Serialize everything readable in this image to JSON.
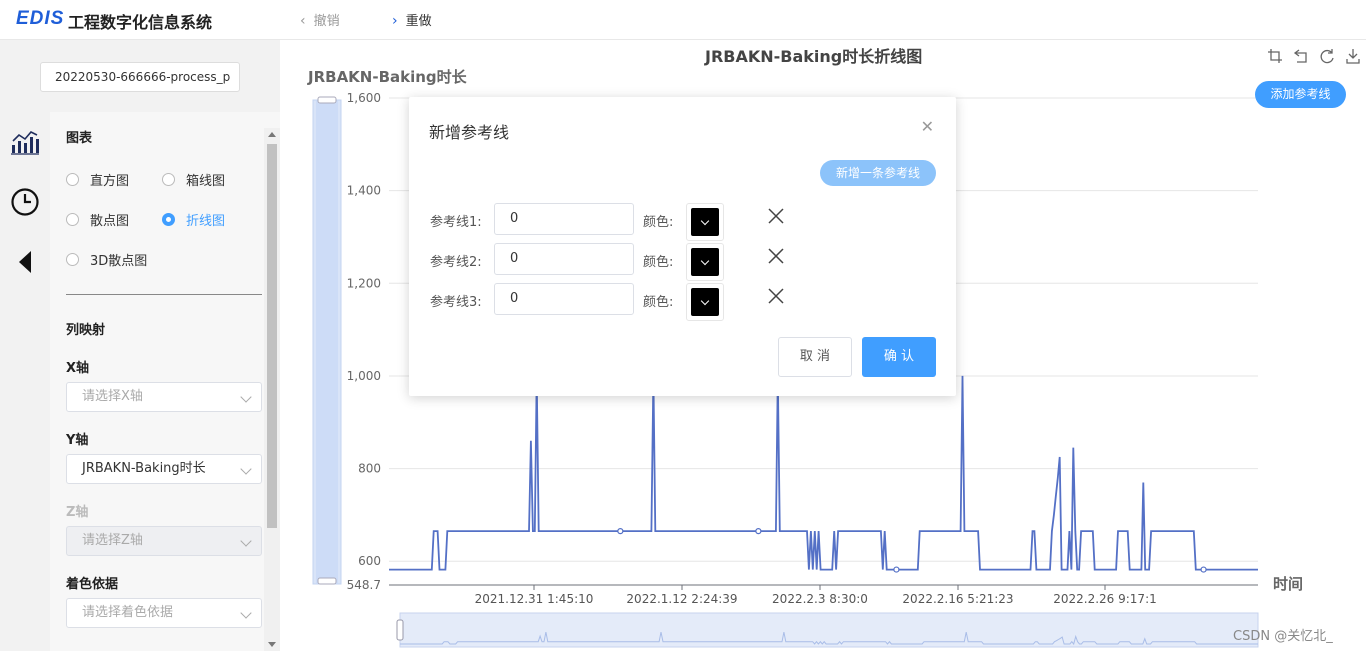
{
  "header": {
    "logo": "EDIS",
    "app_title": "工程数字化信息系统",
    "undo_label": "撤销",
    "redo_label": "重做"
  },
  "sidebar": {
    "file_name": "20220530-666666-process_p",
    "sections": {
      "chart_title": "图表",
      "mapping_title": "列映射",
      "x_axis_label": "X轴",
      "y_axis_label": "Y轴",
      "z_axis_label": "Z轴",
      "color_label": "着色依据"
    },
    "chart_types": [
      {
        "label": "直方图",
        "selected": false
      },
      {
        "label": "箱线图",
        "selected": false
      },
      {
        "label": "散点图",
        "selected": false
      },
      {
        "label": "折线图",
        "selected": true
      },
      {
        "label": "3D散点图",
        "selected": false
      }
    ],
    "x_axis": {
      "placeholder": "请选择X轴",
      "value": ""
    },
    "y_axis": {
      "value": "JRBAKN-Baking时长"
    },
    "z_axis": {
      "placeholder": "请选择Z轴"
    },
    "color_by": {
      "placeholder": "请选择着色依据"
    }
  },
  "chart": {
    "add_ref_button": "添加参考线",
    "toolbox_icons": [
      "crop-icon",
      "restore-icon",
      "refresh-icon",
      "download-icon"
    ],
    "line_color": "#5470c6"
  },
  "chart_data": {
    "type": "line",
    "title": "JRBAKN-Baking时长折线图",
    "ylabel": "JRBAKN-Baking时长",
    "xlabel": "时间",
    "ylim": [
      548.7,
      1600
    ],
    "y_ticks": [
      "1,600",
      "1,400",
      "1,200",
      "1,000",
      "800",
      "600",
      "548.7"
    ],
    "x_ticks": [
      "2021.12.31 1:45:10",
      "2022.1.12 2:24:39",
      "2022.2.3 8:30:0",
      "2022.2.16 5:21:23",
      "2022.2.26 9:17:1"
    ],
    "series": [
      {
        "values": [
          582,
          582,
          582,
          582,
          582,
          582,
          582,
          582,
          582,
          582,
          582,
          582,
          582,
          582,
          582,
          582,
          582,
          582,
          582,
          582,
          582,
          582,
          582,
          665,
          665,
          665,
          582,
          582,
          582,
          582,
          665,
          665,
          665,
          665,
          665,
          665,
          665,
          665,
          665,
          665,
          665,
          665,
          665,
          665,
          665,
          665,
          665,
          665,
          665,
          665,
          665,
          665,
          665,
          665,
          665,
          665,
          665,
          665,
          665,
          665,
          665,
          665,
          665,
          665,
          665,
          665,
          665,
          665,
          665,
          665,
          665,
          665,
          665,
          860,
          665,
          665,
          1000,
          665,
          665,
          665,
          665,
          665,
          665,
          665,
          665,
          665,
          665,
          665,
          665,
          665,
          665,
          665,
          665,
          665,
          665,
          665,
          665,
          665,
          665,
          665,
          665,
          665,
          665,
          665,
          665,
          665,
          665,
          665,
          665,
          665,
          665,
          665,
          665,
          665,
          665,
          665,
          665,
          665,
          665,
          665,
          665,
          665,
          665,
          665,
          665,
          665,
          665,
          665,
          665,
          665,
          665,
          665,
          665,
          665,
          665,
          665,
          1000,
          665,
          665,
          665,
          665,
          665,
          665,
          665,
          665,
          665,
          665,
          665,
          665,
          665,
          665,
          665,
          665,
          665,
          665,
          665,
          665,
          665,
          665,
          665,
          665,
          665,
          665,
          665,
          665,
          665,
          665,
          665,
          665,
          665,
          665,
          665,
          665,
          665,
          665,
          665,
          665,
          665,
          665,
          665,
          665,
          665,
          665,
          665,
          665,
          665,
          665,
          665,
          665,
          665,
          665,
          665,
          665,
          665,
          665,
          665,
          665,
          665,
          665,
          665,
          1000,
          665,
          665,
          665,
          665,
          665,
          665,
          665,
          665,
          665,
          665,
          665,
          665,
          665,
          665,
          665,
          582,
          665,
          582,
          665,
          582,
          665,
          582,
          582,
          582,
          582,
          582,
          582,
          582,
          665,
          582,
          665,
          665,
          665,
          665,
          665,
          665,
          665,
          665,
          665,
          665,
          665,
          665,
          665,
          665,
          665,
          665,
          665,
          665,
          665,
          665,
          665,
          665,
          665,
          582,
          665,
          582,
          582,
          582,
          582,
          582,
          582,
          582,
          582,
          582,
          582,
          582,
          582,
          582,
          582,
          582,
          582,
          582,
          665,
          665,
          665,
          665,
          665,
          665,
          665,
          665,
          665,
          665,
          665,
          665,
          665,
          665,
          665,
          665,
          665,
          665,
          665,
          665,
          665,
          665,
          1000,
          665,
          665,
          665,
          665,
          665,
          665,
          665,
          665,
          582,
          582,
          582,
          582,
          582,
          582,
          582,
          582,
          582,
          582,
          582,
          582,
          582,
          582,
          582,
          582,
          582,
          582,
          582,
          582,
          582,
          582,
          582,
          582,
          582,
          582,
          582,
          665,
          665,
          582,
          582,
          582,
          582,
          582,
          582,
          582,
          582,
          665,
          700,
          740,
          780,
          825,
          582,
          582,
          582,
          582,
          665,
          582,
          845,
          665,
          582,
          582,
          665,
          665,
          665,
          665,
          665,
          665,
          665,
          582,
          582,
          582,
          582,
          582,
          582,
          582,
          582,
          582,
          582,
          582,
          582,
          665,
          665,
          665,
          665,
          665,
          665,
          582,
          582,
          582,
          582,
          582,
          582,
          582,
          770,
          582,
          582,
          582,
          665,
          665,
          665,
          665,
          665,
          665,
          665,
          665,
          665,
          665,
          665,
          665,
          665,
          665,
          665,
          665,
          665,
          665,
          665,
          665,
          665,
          665,
          665,
          582,
          582,
          582,
          582,
          582,
          582,
          582,
          582,
          582,
          582,
          582,
          582,
          582,
          582,
          582,
          582,
          582,
          582,
          582,
          582,
          582,
          582,
          582,
          582,
          582,
          582,
          582,
          582,
          582,
          582,
          582,
          582,
          582
        ]
      }
    ]
  },
  "dialog": {
    "title": "新增参考线",
    "new_line_button": "新增一条参考线",
    "color_label": "颜色:",
    "rows": [
      {
        "label": "参考线1:",
        "value": "0",
        "color": "#000000"
      },
      {
        "label": "参考线2:",
        "value": "0",
        "color": "#000000"
      },
      {
        "label": "参考线3:",
        "value": "0",
        "color": "#000000"
      }
    ],
    "cancel_label": "取 消",
    "confirm_label": "确 认"
  },
  "footer": {
    "watermark": "CSDN @关忆北_"
  }
}
